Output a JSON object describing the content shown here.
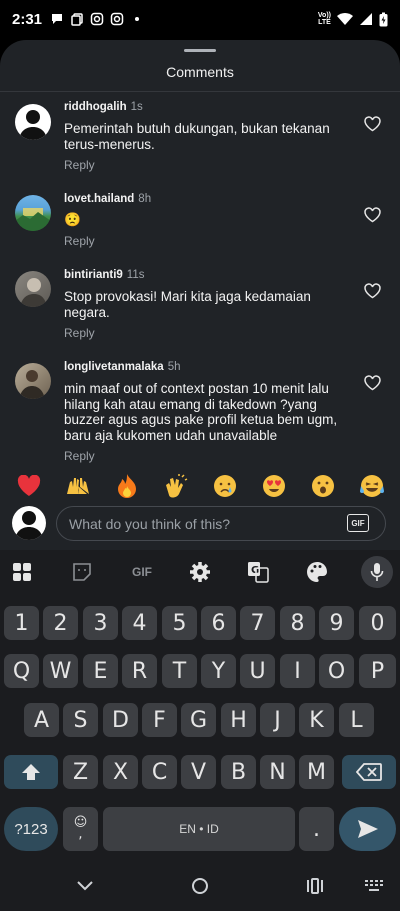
{
  "status": {
    "time": "2:31",
    "network_top": "Vo))",
    "network_bottom": "LTE"
  },
  "sheet": {
    "title": "Comments"
  },
  "comments": [
    {
      "user": "riddhogalih",
      "time": "1s",
      "text": "Pemerintah butuh dukungan, bukan tekanan terus-menerus.",
      "reply": "Reply",
      "avatar": "silhouette"
    },
    {
      "user": "lovet.hailand",
      "time": "8h",
      "text": "😟",
      "reply": "Reply",
      "avatar": "landscape"
    },
    {
      "user": "bintirianti9",
      "time": "11s",
      "text": "Stop provokasi! Mari kita jaga kedamaian negara.",
      "reply": "Reply",
      "avatar": "photo-gray"
    },
    {
      "user": "longlivetanmalaka",
      "time": "5h",
      "text": "min maaf out of context postan 10 menit lalu hilang kah atau emang di takedown ?yang buzzer agus agus pake profil ketua bem ugm, baru aja kukomen udah unavailable",
      "reply": "Reply",
      "avatar": "photo-person"
    }
  ],
  "emoji_bar": [
    "❤️",
    "🙌",
    "🔥",
    "👏",
    "😢",
    "😍",
    "😮",
    "😂"
  ],
  "composer": {
    "placeholder": "What do you think of this?",
    "gif_label": "GIF"
  },
  "keyboard": {
    "toolbar_gif": "GIF",
    "row_numbers": [
      "1",
      "2",
      "3",
      "4",
      "5",
      "6",
      "7",
      "8",
      "9",
      "0"
    ],
    "row1": [
      "Q",
      "W",
      "E",
      "R",
      "T",
      "Y",
      "U",
      "I",
      "O",
      "P"
    ],
    "row2": [
      "A",
      "S",
      "D",
      "F",
      "G",
      "H",
      "J",
      "K",
      "L"
    ],
    "row3": [
      "Z",
      "X",
      "C",
      "V",
      "B",
      "N",
      "M"
    ],
    "symbols_key": "?123",
    "space_label": "EN • ID",
    "period_key": ".",
    "emoji_comma_top": "☺",
    "emoji_comma_bottom": ","
  },
  "colors": {
    "sheet_bg": "#202327",
    "keyboard_bg": "#1b1c1f",
    "key_bg": "#3d3f43",
    "accent_key": "#2f4b5b"
  }
}
